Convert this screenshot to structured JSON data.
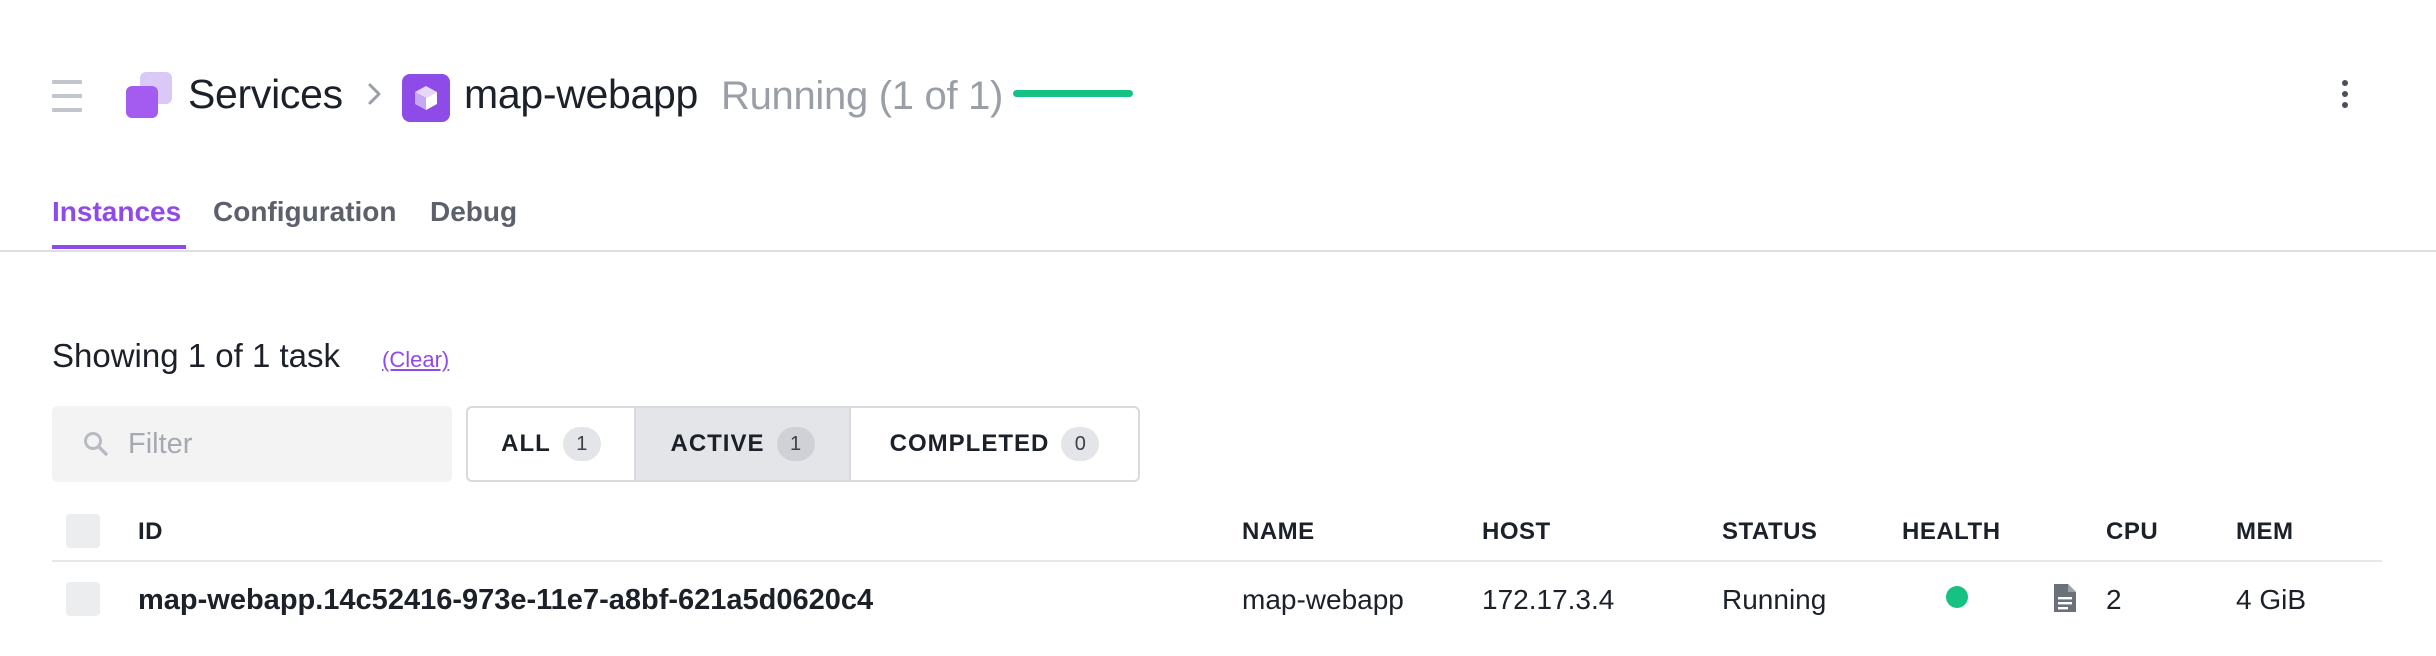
{
  "header": {
    "breadcrumb_root": "Services",
    "service_name": "map-webapp",
    "service_status": "Running (1 of 1)",
    "status_progress_fraction": 1.0,
    "status_color": "#16c184",
    "accent_color": "#8f4be8"
  },
  "tabs": [
    {
      "label": "Instances",
      "active": true
    },
    {
      "label": "Configuration",
      "active": false
    },
    {
      "label": "Debug",
      "active": false
    }
  ],
  "summary": {
    "text": "Showing 1 of 1 task",
    "clear_label": "(Clear)"
  },
  "filter": {
    "placeholder": "Filter",
    "value": ""
  },
  "status_filters": [
    {
      "label": "ALL",
      "count": "1",
      "active": false
    },
    {
      "label": "ACTIVE",
      "count": "1",
      "active": true
    },
    {
      "label": "COMPLETED",
      "count": "0",
      "active": false
    }
  ],
  "table": {
    "columns": [
      "ID",
      "NAME",
      "HOST",
      "STATUS",
      "HEALTH",
      "CPU",
      "MEM"
    ],
    "rows": [
      {
        "id": "map-webapp.14c52416-973e-11e7-a8bf-621a5d0620c4",
        "name": "map-webapp",
        "host": "172.17.3.4",
        "status": "Running",
        "health": "healthy",
        "cpu": "2",
        "mem": "4 GiB"
      }
    ]
  },
  "icons": {
    "menu": "hamburger-menu-icon",
    "services": "services-stack-icon",
    "breadcrumb_separator": "chevron-right-icon",
    "service": "service-cube-icon",
    "more": "more-vertical-icon",
    "search": "search-icon",
    "logs": "log-file-icon"
  }
}
